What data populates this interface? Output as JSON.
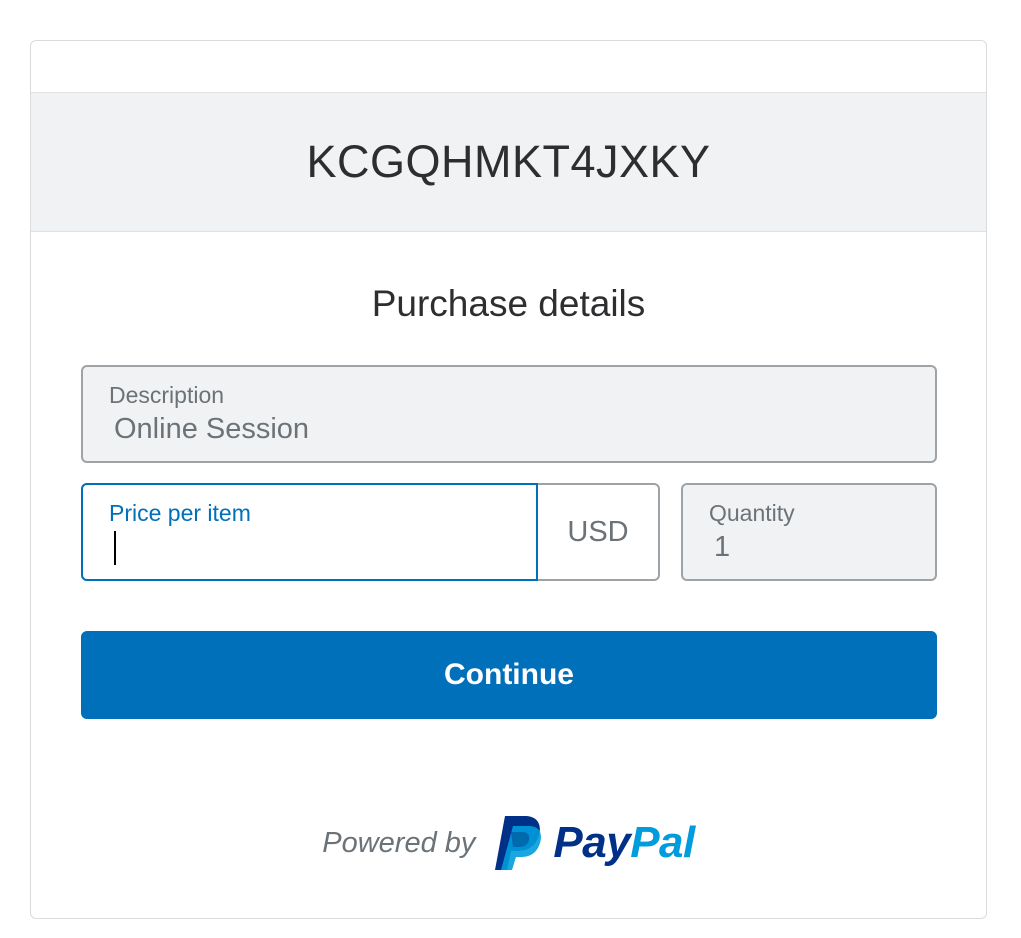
{
  "merchant": {
    "id": "KCGQHMKT4JXKY"
  },
  "form": {
    "title": "Purchase details",
    "description": {
      "label": "Description",
      "value": "Online Session"
    },
    "price": {
      "label": "Price per item",
      "value": "",
      "currency": "USD"
    },
    "quantity": {
      "label": "Quantity",
      "value": "1"
    },
    "continue_label": "Continue"
  },
  "footer": {
    "powered_by": "Powered by",
    "brand_pay": "Pay",
    "brand_pal": "Pal"
  },
  "colors": {
    "accent": "#0070ba",
    "brand_dark": "#003087",
    "brand_light": "#009cde"
  }
}
